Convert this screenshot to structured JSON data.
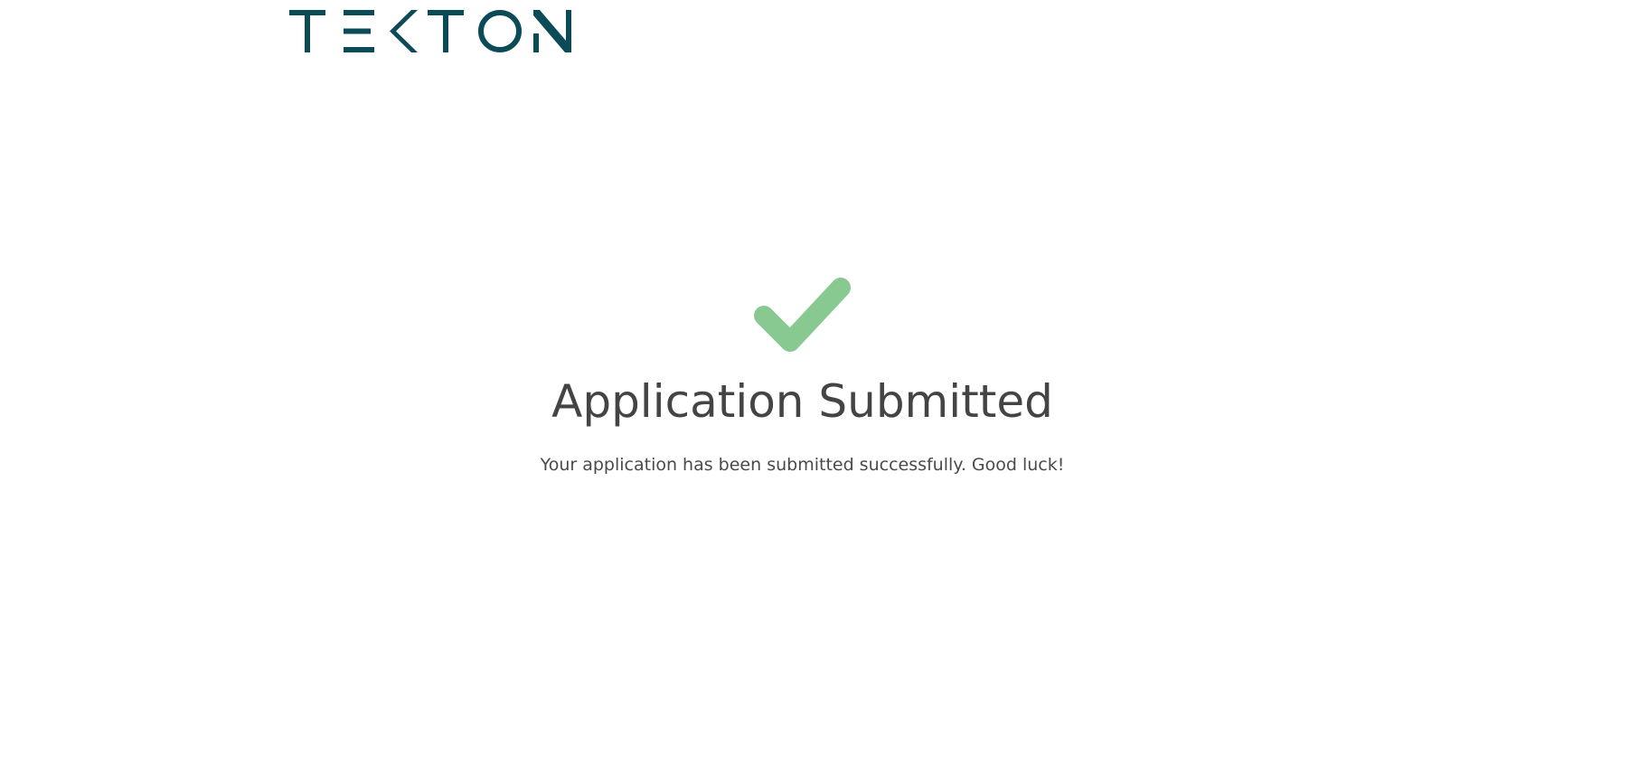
{
  "header": {
    "logo_text": "TEKTON",
    "logo_color": "#0b4a57"
  },
  "confirmation": {
    "icon": "checkmark-icon",
    "icon_color": "#88c891",
    "title": "Application Submitted",
    "message": "Your application has been submitted successfully. Good luck!"
  }
}
